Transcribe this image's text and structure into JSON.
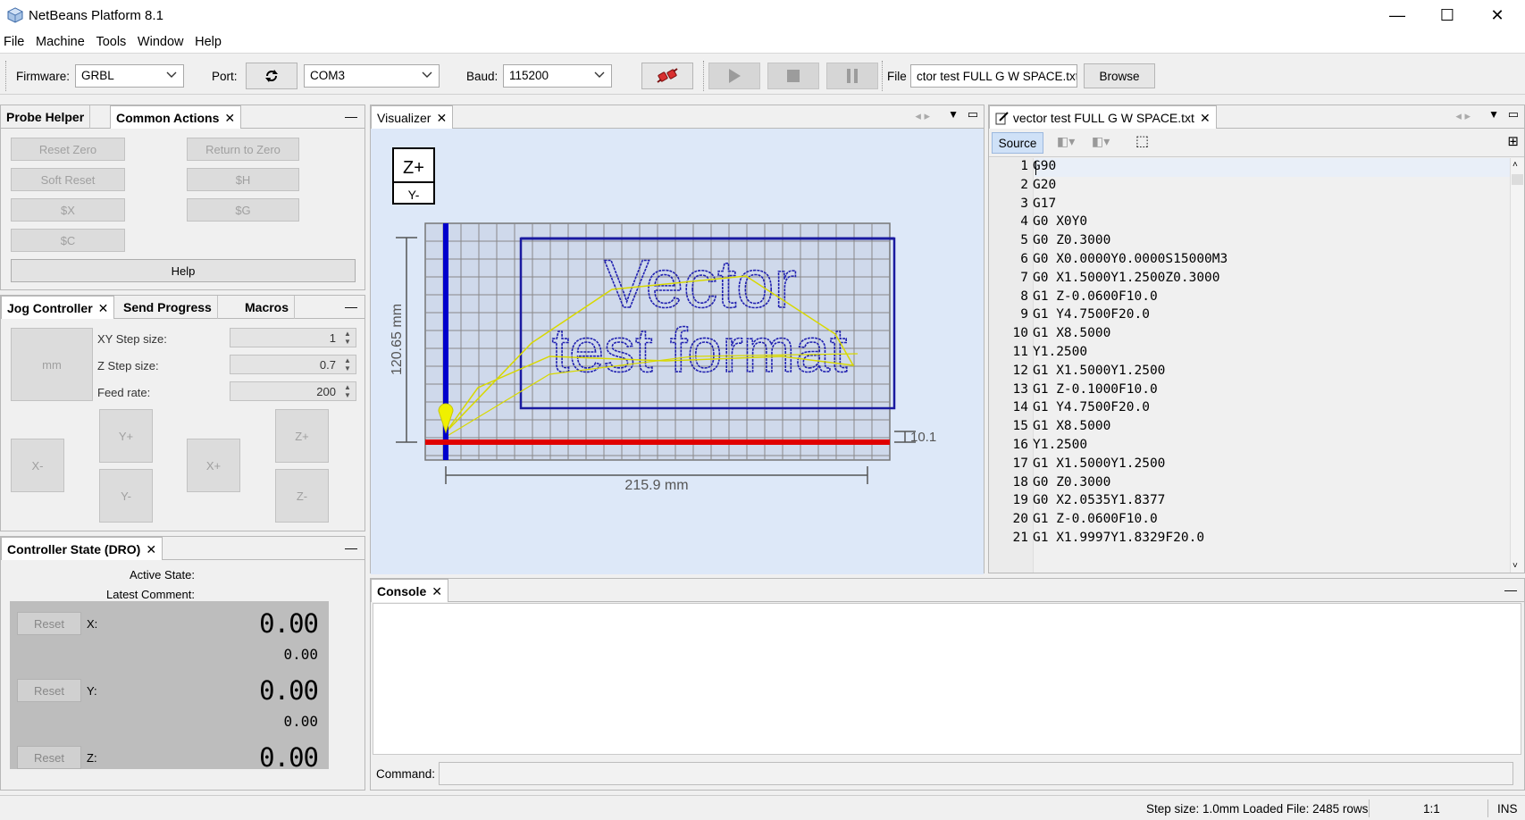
{
  "window": {
    "title": "NetBeans Platform 8.1",
    "minimize": "—",
    "maximize": "☐",
    "close": "✕"
  },
  "menu": [
    "File",
    "Machine",
    "Tools",
    "Window",
    "Help"
  ],
  "toolbar": {
    "firmware_label": "Firmware:",
    "firmware_value": "GRBL",
    "port_label": "Port:",
    "port_value": "COM3",
    "baud_label": "Baud:",
    "baud_value": "115200",
    "file_label": "File",
    "file_value": "ctor test FULL G W SPACE.txt",
    "browse_label": "Browse"
  },
  "common_actions": {
    "tabs": [
      "Probe Helper",
      "Common Actions"
    ],
    "buttons": {
      "reset_zero": "Reset Zero",
      "return_to_zero": "Return to Zero",
      "soft_reset": "Soft Reset",
      "h": "$H",
      "x": "$X",
      "g": "$G",
      "c": "$C",
      "help": "Help"
    }
  },
  "jog": {
    "tabs": [
      "Jog Controller",
      "Send Progress",
      "Macros"
    ],
    "unit_button": "mm",
    "xy_step_label": "XY Step size:",
    "xy_step_value": "1",
    "z_step_label": "Z Step size:",
    "z_step_value": "0.7",
    "feed_label": "Feed rate:",
    "feed_value": "200",
    "y_plus": "Y+",
    "y_minus": "Y-",
    "x_plus": "X+",
    "x_minus": "X-",
    "z_plus": "Z+",
    "z_minus": "Z-"
  },
  "dro": {
    "tab": "Controller State (DRO)",
    "active_state_label": "Active State:",
    "latest_comment_label": "Latest Comment:",
    "reset_label": "Reset",
    "x_label": "X:",
    "y_label": "Y:",
    "z_label": "Z:",
    "x_work": "0.00",
    "x_machine": "0.00",
    "y_work": "0.00",
    "y_machine": "0.00",
    "z_work": "0.00"
  },
  "visualizer": {
    "tab": "Visualizer",
    "zplus": "Z+",
    "yminus": "Y-",
    "width_label": "215.9 mm",
    "height_label": "120.65 mm",
    "z_label": "10.1",
    "text_line1": "Vector",
    "text_line2": "test format",
    "colors": {
      "background": "#dde8f8",
      "x_axis": "#e00000",
      "y_axis": "#0000cc",
      "toolpath": "#d8d800",
      "grid": "#888888"
    }
  },
  "editor": {
    "tab": "vector test FULL G W SPACE.txt",
    "source_label": "Source",
    "lines": [
      {
        "n": "1",
        "code": "G90"
      },
      {
        "n": "2",
        "code": "G20"
      },
      {
        "n": "3",
        "code": "G17"
      },
      {
        "n": "4",
        "code": "G0 X0Y0"
      },
      {
        "n": "5",
        "code": "G0 Z0.3000"
      },
      {
        "n": "6",
        "code": "G0 X0.0000Y0.0000S15000M3"
      },
      {
        "n": "7",
        "code": "G0 X1.5000Y1.2500Z0.3000"
      },
      {
        "n": "8",
        "code": "G1 Z-0.0600F10.0"
      },
      {
        "n": "9",
        "code": "G1 Y4.7500F20.0"
      },
      {
        "n": "10",
        "code": "G1 X8.5000"
      },
      {
        "n": "11",
        "code": "Y1.2500"
      },
      {
        "n": "12",
        "code": "G1 X1.5000Y1.2500"
      },
      {
        "n": "13",
        "code": "G1 Z-0.1000F10.0"
      },
      {
        "n": "14",
        "code": "G1 Y4.7500F20.0"
      },
      {
        "n": "15",
        "code": "G1 X8.5000"
      },
      {
        "n": "16",
        "code": "Y1.2500"
      },
      {
        "n": "17",
        "code": "G1 X1.5000Y1.2500"
      },
      {
        "n": "18",
        "code": "G0 Z0.3000"
      },
      {
        "n": "19",
        "code": "G0 X2.0535Y1.8377"
      },
      {
        "n": "20",
        "code": "G1 Z-0.0600F10.0"
      },
      {
        "n": "21",
        "code": "G1 X1.9997Y1.8329F20.0"
      }
    ]
  },
  "console": {
    "tab": "Console",
    "command_label": "Command:"
  },
  "status": {
    "text": "Step size: 1.0mm Loaded File: 2485 rows",
    "position": "1:1",
    "mode": "INS"
  }
}
